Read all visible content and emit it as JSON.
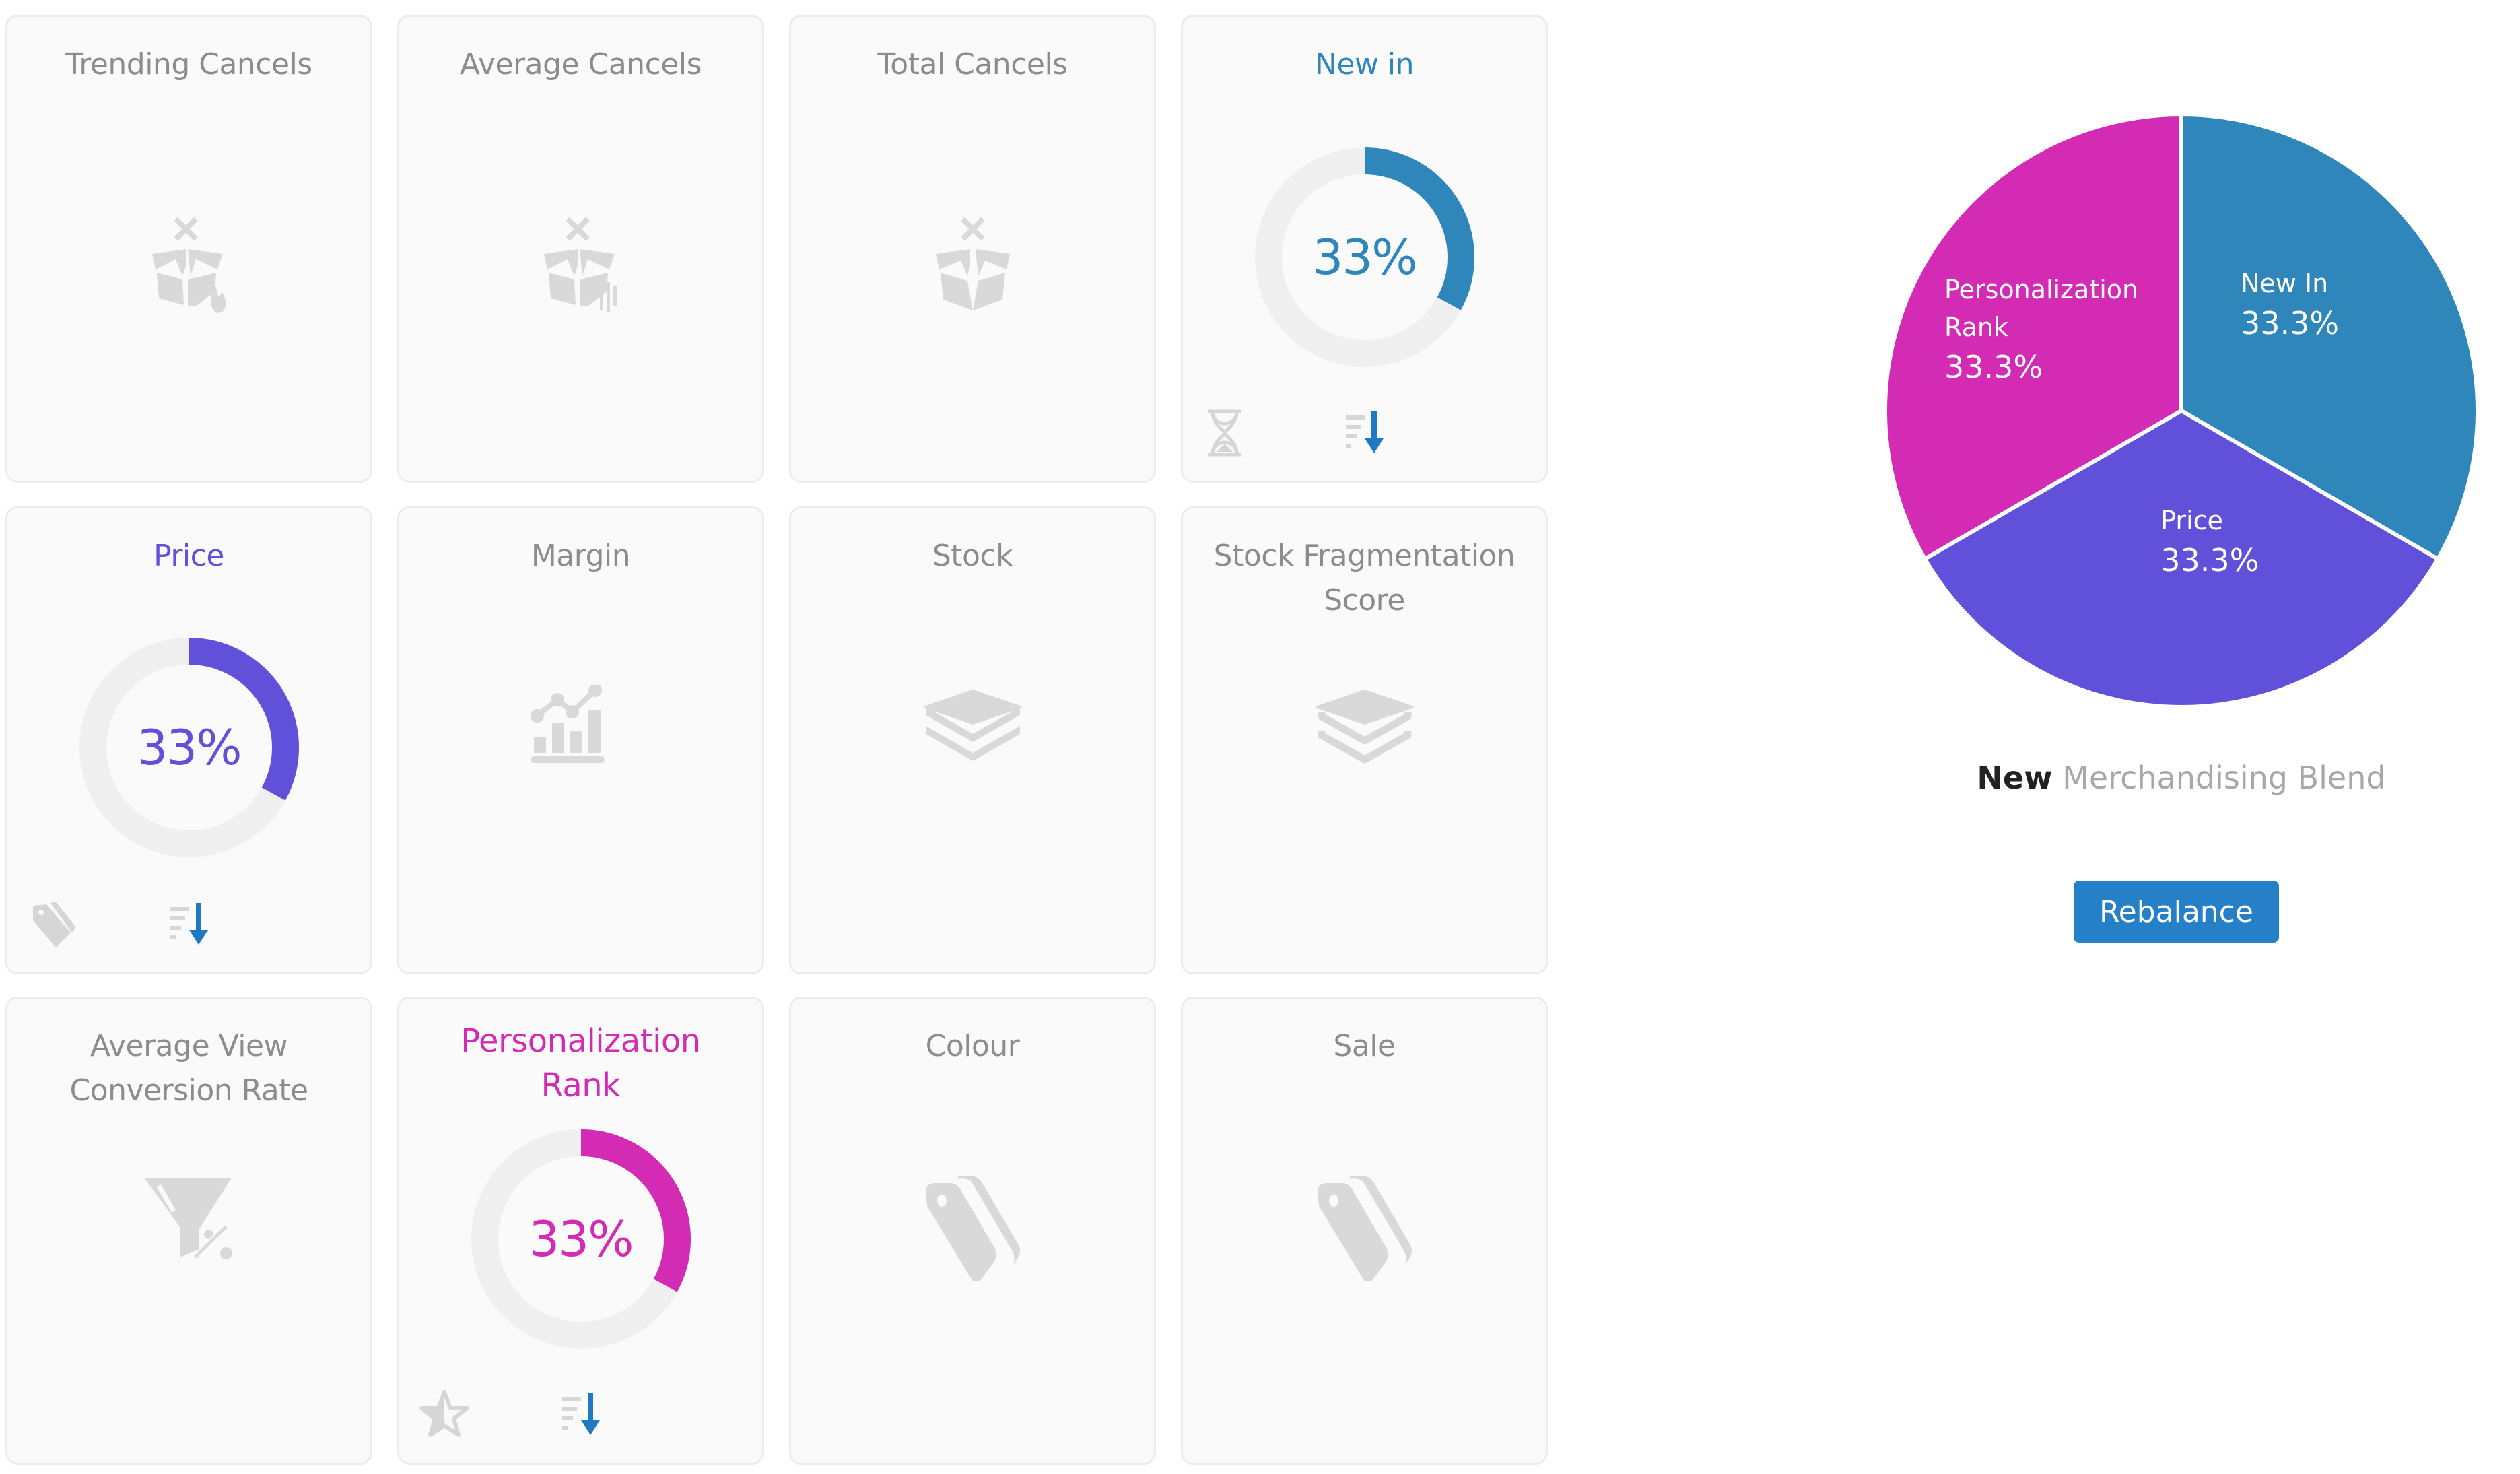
{
  "cards": [
    {
      "title": "Trending Cancels",
      "icon": "box-cancel-trending-icon",
      "active": false
    },
    {
      "title": "Average Cancels",
      "icon": "box-cancel-average-icon",
      "active": false
    },
    {
      "title": "Total Cancels",
      "icon": "box-cancel-icon",
      "active": false
    },
    {
      "title": "New in",
      "active": true,
      "percent_label": "33%",
      "percent_value": 33,
      "color": "#2e86bb",
      "footer_icons": [
        "hourglass-icon",
        "sort-descending-icon"
      ]
    },
    {
      "title": "Price",
      "active": true,
      "percent_label": "33%",
      "percent_value": 33,
      "color": "#6150d9",
      "footer_icons": [
        "price-tag-icon",
        "sort-descending-icon"
      ]
    },
    {
      "title": "Margin",
      "icon": "chart-growth-icon",
      "active": false
    },
    {
      "title": "Stock",
      "icon": "layers-icon",
      "active": false
    },
    {
      "title": "Stock Fragmentation Score",
      "icon": "layers-outline-icon",
      "active": false
    },
    {
      "title": "Average View Conversion Rate",
      "icon": "funnel-percent-icon",
      "active": false
    },
    {
      "title": "Personalization Rank",
      "active": true,
      "percent_label": "33%",
      "percent_value": 33,
      "color": "#d42bb4",
      "footer_icons": [
        "star-half-icon",
        "sort-descending-icon"
      ]
    },
    {
      "title": "Colour",
      "icon": "tags-icon",
      "active": false
    },
    {
      "title": "Sale",
      "icon": "tags-icon",
      "active": false
    }
  ],
  "colors": {
    "inactive_text": "#8c8c8c",
    "inactive_icon": "#d9d9d9",
    "track": "#efefef",
    "sort_arrow": "#1f78c4",
    "button": "#2680c8"
  },
  "blend": {
    "caption_bold": "New",
    "caption_rest": "Merchandising Blend",
    "button_label": "Rebalance"
  },
  "chart_data": {
    "type": "pie",
    "title": "New Merchandising Blend",
    "start_angle": "12 o'clock, clockwise",
    "slices": [
      {
        "label": "New In",
        "value": 33.3,
        "value_label": "33.3%",
        "color": "#2e86bb"
      },
      {
        "label": "Price",
        "value": 33.3,
        "value_label": "33.3%",
        "color": "#6150d9"
      },
      {
        "label": "Personalization Rank",
        "value": 33.3,
        "value_label": "33.3%",
        "color": "#d42bb4"
      }
    ]
  }
}
